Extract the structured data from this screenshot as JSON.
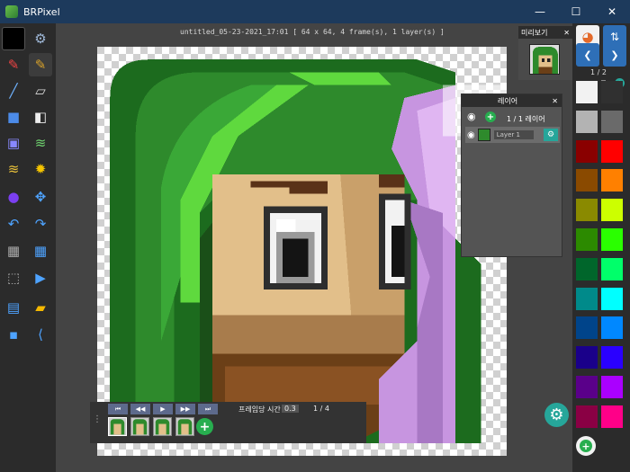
{
  "window": {
    "title": "BRPixel",
    "minimize": "—",
    "maximize": "☐",
    "close": "✕"
  },
  "document": {
    "info": "untitled_05-23-2021_17:01  [ 64 x 64, 4 frame(s), 1 layer(s) ]"
  },
  "preview": {
    "title": "미리보기",
    "close": "✕"
  },
  "layers": {
    "title": "레이어",
    "close": "✕",
    "count": "1 / 1 레이어",
    "items": [
      {
        "name": "Layer 1"
      }
    ]
  },
  "palette": {
    "page": "1 / 2",
    "swatches": [
      "#f2f2f2",
      "#303030",
      "#b3b3b3",
      "#6a6a6a",
      "#8a0000",
      "#ff0000",
      "#8a4a00",
      "#ff8000",
      "#8a8a00",
      "#ccff00",
      "#2c8a00",
      "#2aff00",
      "#00662b",
      "#00ff6a",
      "#008a8a",
      "#00ffff",
      "#00448a",
      "#0088ff",
      "#1a008a",
      "#2a00ff",
      "#5a008a",
      "#aa00ff",
      "#8a0044",
      "#ff0088"
    ]
  },
  "animation": {
    "controls": [
      "⏮",
      "◀◀",
      "▶",
      "▶▶",
      "⏭"
    ],
    "label": "프레임당 시간",
    "time": "0.3",
    "frame_counter": "1 / 4",
    "frames": [
      "frame-1",
      "frame-2",
      "frame-3",
      "frame-4"
    ]
  },
  "colors": {
    "accent": "#26a69a",
    "titlebar": "#1d3a5c",
    "nav": "#2e6fb7",
    "add": "#27ae4f"
  }
}
